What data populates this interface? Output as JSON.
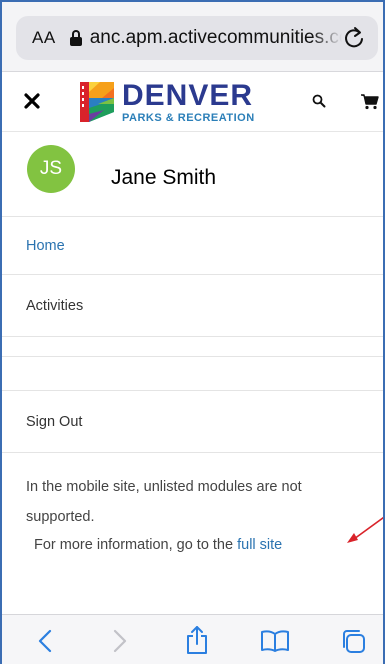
{
  "browser": {
    "text_size_label": "AA",
    "url": "anc.apm.activecommunities.com",
    "icons": [
      "lock-icon",
      "reload-icon",
      "back-icon",
      "forward-icon",
      "share-icon",
      "bookmarks-icon",
      "tabs-icon"
    ]
  },
  "header": {
    "logo_title": "DENVER",
    "logo_subtitle": "PARKS & RECREATION",
    "icons": [
      "close-icon",
      "search-icon",
      "cart-icon"
    ]
  },
  "profile": {
    "initials": "JS",
    "name": "Jane Smith",
    "avatar_color": "#82c341"
  },
  "menu": {
    "items": [
      {
        "label": "Home",
        "active": true
      },
      {
        "label": "Activities",
        "active": false
      },
      {
        "label": "",
        "active": false
      },
      {
        "label": "",
        "active": false
      },
      {
        "label": "Sign Out",
        "active": false
      }
    ]
  },
  "footer_note": {
    "unlisted_text": "In the mobile site, unlisted modules are not supported.",
    "more_info_prefix": "For more information, go to the",
    "full_site_link": "full site"
  },
  "colors": {
    "link": "#2a73b0",
    "brand_navy": "#2b3a8f",
    "annotation_arrow": "#d9232a"
  }
}
